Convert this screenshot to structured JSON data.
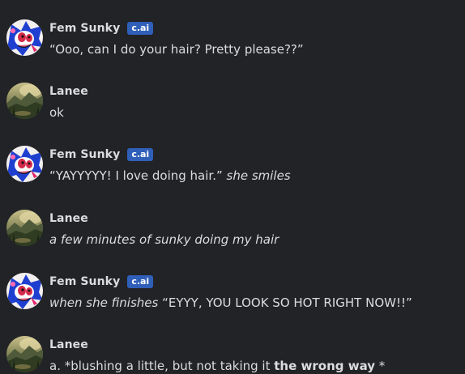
{
  "messages": [
    {
      "author": "Fem Sunky",
      "badge": "c.ai",
      "avatar": "sonic-character-avatar",
      "parts": [
        {
          "t": "“Ooo, can I do your hair? Pretty please??”",
          "s": "normal"
        }
      ]
    },
    {
      "author": "Lanee",
      "avatar": "landscape-avatar",
      "parts": [
        {
          "t": "ok",
          "s": "normal"
        }
      ]
    },
    {
      "author": "Fem Sunky",
      "badge": "c.ai",
      "avatar": "sonic-character-avatar",
      "parts": [
        {
          "t": "“YAYYYYY! I love doing hair.”",
          "s": "normal"
        },
        {
          "t": " she smiles",
          "s": "italic"
        }
      ]
    },
    {
      "author": "Lanee",
      "avatar": "landscape-avatar",
      "parts": [
        {
          "t": "a few minutes of sunky doing my hair",
          "s": "italic"
        }
      ]
    },
    {
      "author": "Fem Sunky",
      "badge": "c.ai",
      "avatar": "sonic-character-avatar",
      "parts": [
        {
          "t": "when she finishes",
          "s": "italic"
        },
        {
          "t": " “EYYY, YOU LOOK SO HOT RIGHT NOW!!”",
          "s": "normal"
        }
      ]
    },
    {
      "author": "Lanee",
      "avatar": "landscape-avatar",
      "parts": [
        {
          "t": "a. *blushing a little, but not taking it ",
          "s": "normal"
        },
        {
          "t": "the wrong way",
          "s": "bold"
        },
        {
          "t": " *",
          "s": "normal"
        }
      ]
    }
  ],
  "colors": {
    "background": "#222326",
    "badge": "#2f5fb8",
    "text": "#dcdcde"
  }
}
